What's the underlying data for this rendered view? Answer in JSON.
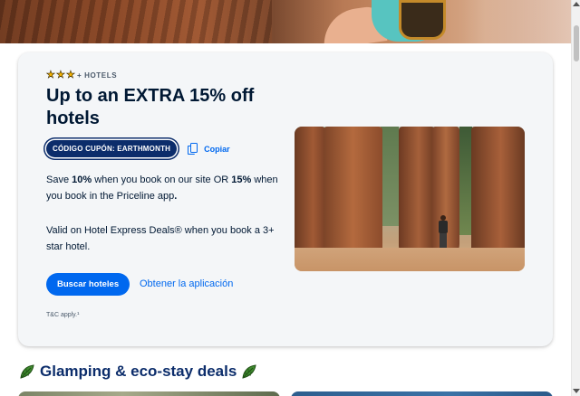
{
  "promo": {
    "stars": [
      "★",
      "★",
      "★"
    ],
    "stars_suffix": "+ HOTELS",
    "title": "Up to an EXTRA 15% off hotels",
    "coupon_label": "CÓDIGO CUPÓN: EARTHMONTH",
    "copy_label": "Copiar",
    "desc_part1": "Save ",
    "desc_pct1": "10%",
    "desc_part2": " when you book on our site OR ",
    "desc_pct2": "15%",
    "desc_part3": " when you book in the Priceline app",
    "desc_part4": ".",
    "desc2": "Valid on Hotel Express Deals® when you book a 3+ star hotel.",
    "primary_button": "Buscar hoteles",
    "app_link": "Obtener la aplicación",
    "terms": "T&C apply.¹"
  },
  "section": {
    "title": "Glamping & eco-stay deals"
  },
  "colors": {
    "accent": "#0068ef",
    "heading": "#0c2d6b",
    "star": "#f6b400"
  },
  "icons": {
    "copy": "copy-icon",
    "leaf": "leaf-icon",
    "star": "star-icon"
  }
}
